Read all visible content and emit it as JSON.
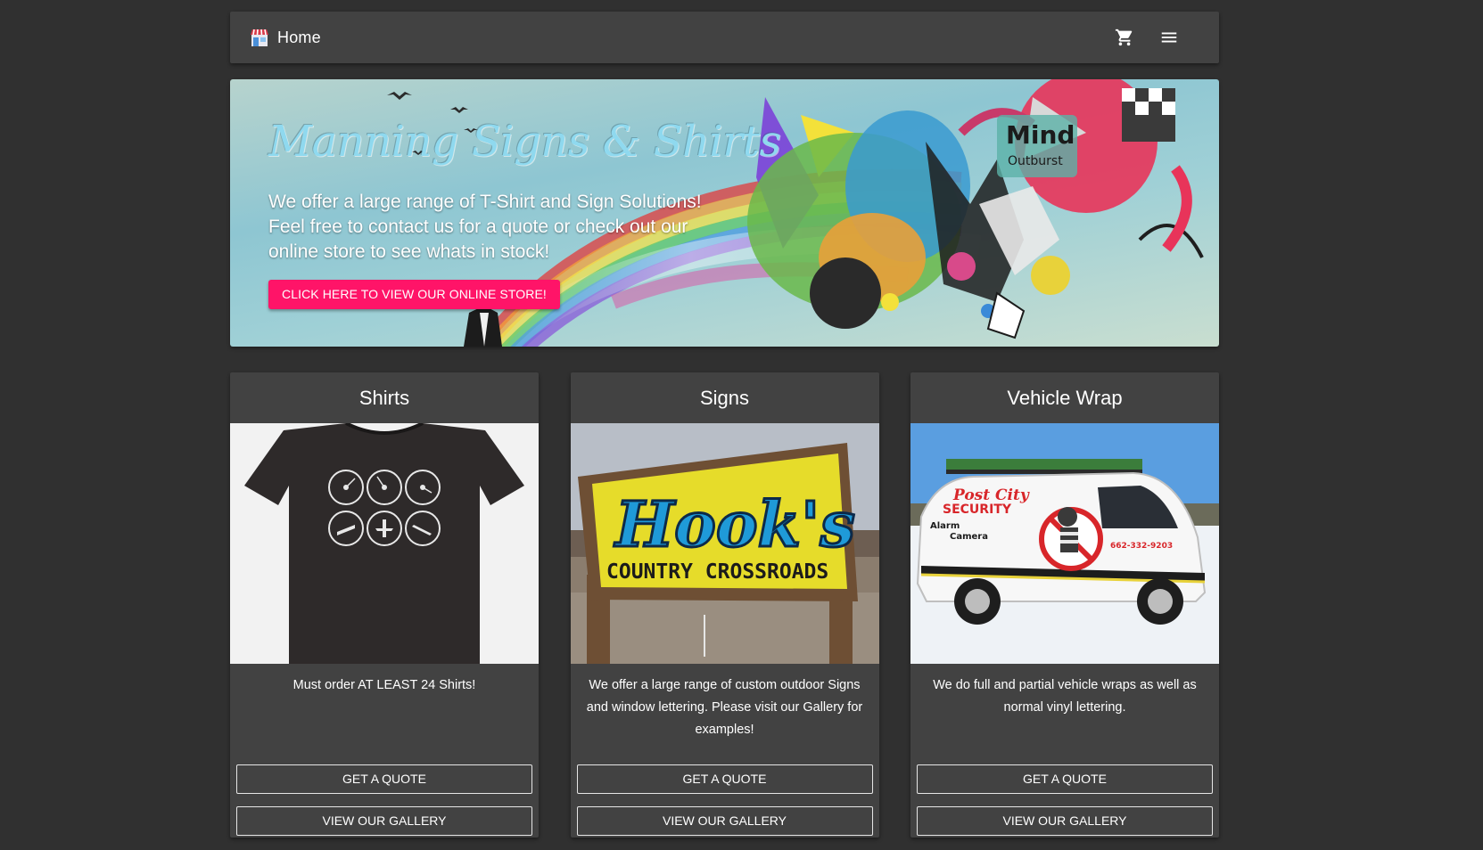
{
  "nav": {
    "home_label": "Home",
    "icons": [
      "storefront-icon",
      "cart-icon",
      "menu-icon"
    ]
  },
  "hero": {
    "title": "Manning Signs & Shirts",
    "text": "We offer a large range of T-Shirt and Sign Solutions! Feel free to contact us for a quote or check out our online store to see whats in stock!",
    "button_label": "CLICK HERE TO VIEW OUR ONLINE STORE!",
    "accent_color": "#ff1468",
    "art_text": "Mind Outburst"
  },
  "cards": [
    {
      "title": "Shirts",
      "description": "Must order AT LEAST 24 Shirts!",
      "quote_label": "GET A QUOTE",
      "gallery_label": "VIEW OUR GALLERY"
    },
    {
      "title": "Signs",
      "description": "We offer a large range of custom outdoor Signs and window lettering. Please visit our Gallery for examples!",
      "quote_label": "GET A QUOTE",
      "gallery_label": "VIEW OUR GALLERY",
      "sign_text_main": "Hook's",
      "sign_text_sub": "COUNTRY CROSSROADS"
    },
    {
      "title": "Vehicle Wrap",
      "description": "We do full and partial vehicle wraps as well as normal vinyl lettering.",
      "quote_label": "GET A QUOTE",
      "gallery_label": "VIEW OUR GALLERY",
      "van_text_1": "Post City",
      "van_text_2": "SECURITY",
      "van_text_3": "Alarm",
      "van_text_4": "Camera",
      "van_phone": "662-332-9203"
    }
  ]
}
